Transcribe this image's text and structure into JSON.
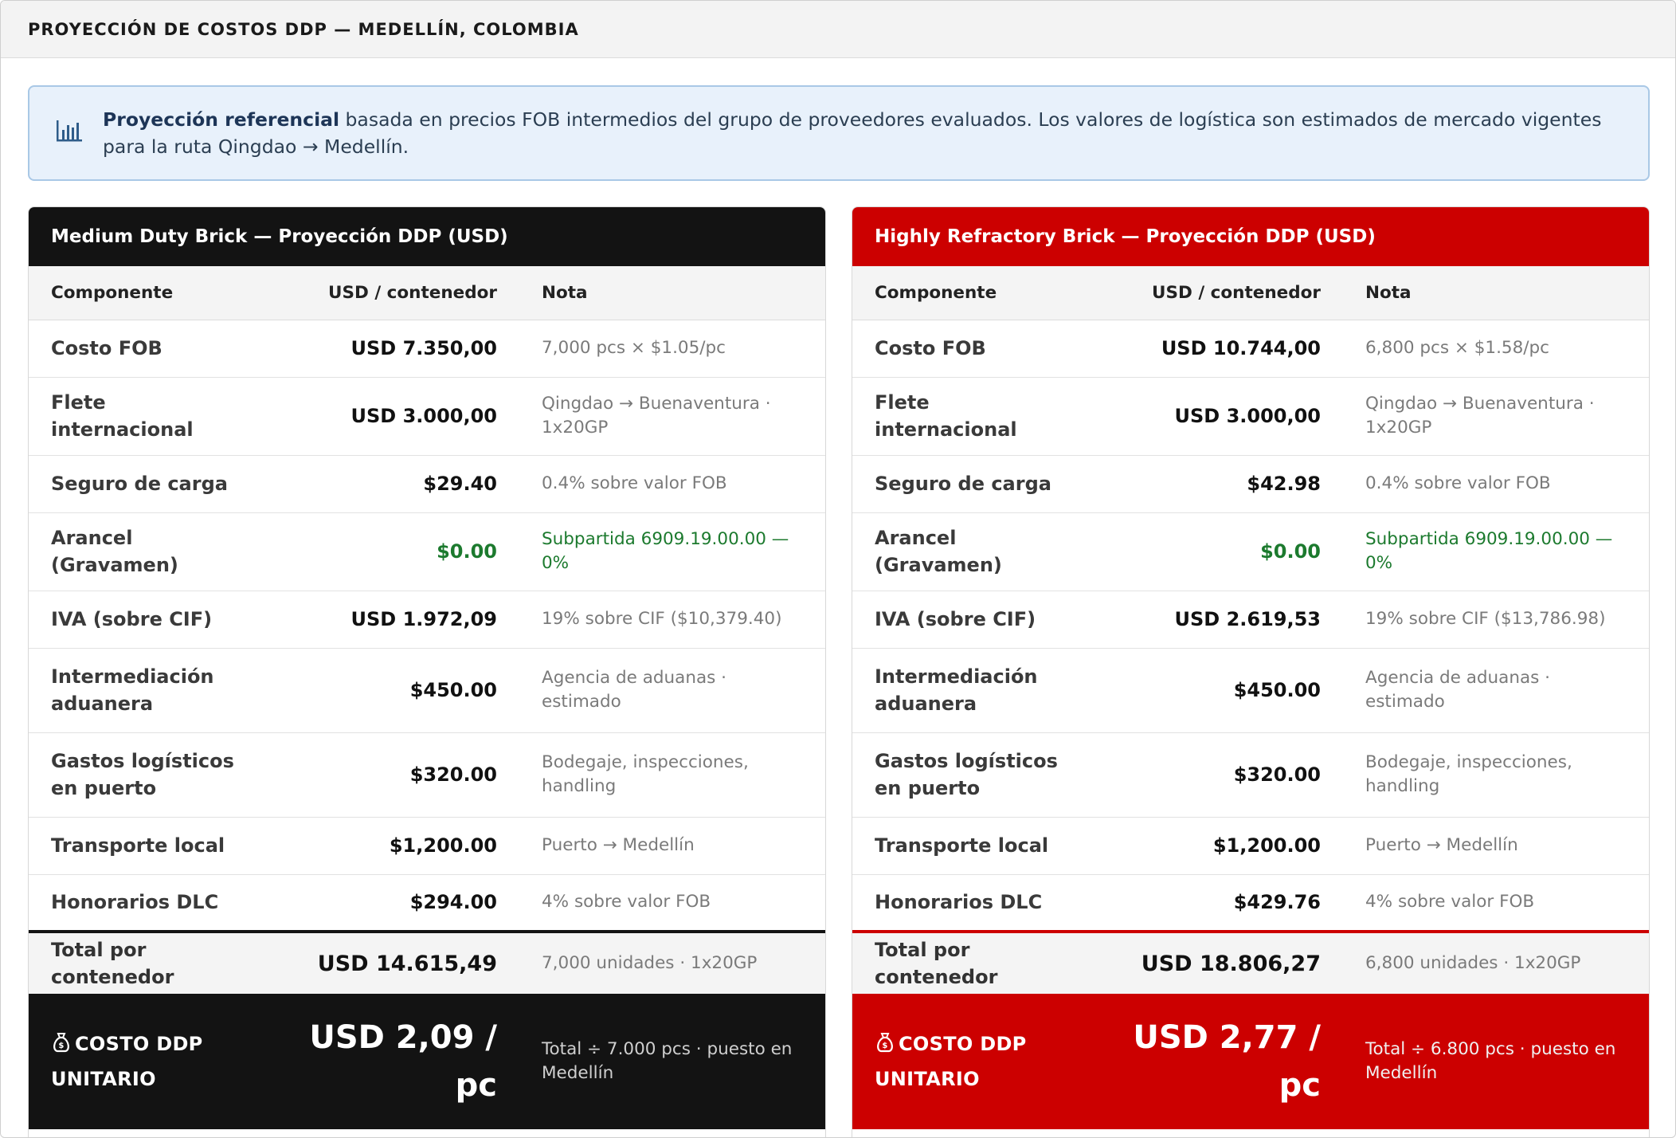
{
  "header": {
    "title": "PROYECCIÓN DE COSTOS DDP — MEDELLÍN, COLOMBIA"
  },
  "info": {
    "icon": "bar-chart-icon",
    "bold": "Proyección referencial",
    "text": " basada en precios FOB intermedios del grupo de proveedores evaluados. Los valores de logística son estimados de mercado vigentes para la ruta Qingdao → Medellín."
  },
  "colors": {
    "left_accent": "#131313",
    "right_accent": "#cc0000",
    "green": "#1c7a2e",
    "info_bg": "#e8f1fb"
  },
  "columns": {
    "component": "Componente",
    "usd": "USD / contenedor",
    "note": "Nota"
  },
  "panels": [
    {
      "title": "Medium Duty Brick — Proyección DDP (USD)",
      "rows": [
        {
          "label": "Costo FOB",
          "value": "USD 7.350,00",
          "note": "7,000 pcs × $1.05/pc"
        },
        {
          "label": "Flete internacional",
          "value": "USD 3.000,00",
          "note": "Qingdao → Buenaventura · 1x20GP"
        },
        {
          "label": "Seguro de carga",
          "value": "$29.40",
          "note": "0.4% sobre valor FOB"
        },
        {
          "label": "Arancel (Gravamen)",
          "value": "$0.00",
          "note": "Subpartida 6909.19.00.00 — 0%"
        },
        {
          "label": "IVA (sobre CIF)",
          "value": "USD 1.972,09",
          "note": "19% sobre CIF ($10,379.40)"
        },
        {
          "label": "Intermediación aduanera",
          "value": "$450.00",
          "note": "Agencia de aduanas · estimado"
        },
        {
          "label": "Gastos logísticos en puerto",
          "value": "$320.00",
          "note": "Bodegaje, inspecciones, handling"
        },
        {
          "label": "Transporte local",
          "value": "$1,200.00",
          "note": "Puerto → Medellín"
        },
        {
          "label": "Honorarios DLC",
          "value": "$294.00",
          "note": "4% sobre valor FOB"
        }
      ],
      "total": {
        "label": "Total por contenedor",
        "value": "USD 14.615,49",
        "note": "7,000 unidades · 1x20GP"
      },
      "unit": {
        "icon": "money-bag-icon",
        "label": "COSTO DDP UNITARIO",
        "value": "USD 2,09 / pc",
        "note": "Total ÷ 7.000 pcs · puesto en Medellín"
      }
    },
    {
      "title": "Highly Refractory Brick — Proyección DDP (USD)",
      "rows": [
        {
          "label": "Costo FOB",
          "value": "USD 10.744,00",
          "note": "6,800 pcs × $1.58/pc"
        },
        {
          "label": "Flete internacional",
          "value": "USD 3.000,00",
          "note": "Qingdao → Buenaventura · 1x20GP"
        },
        {
          "label": "Seguro de carga",
          "value": "$42.98",
          "note": "0.4% sobre valor FOB"
        },
        {
          "label": "Arancel (Gravamen)",
          "value": "$0.00",
          "note": "Subpartida 6909.19.00.00 — 0%"
        },
        {
          "label": "IVA (sobre CIF)",
          "value": "USD 2.619,53",
          "note": "19% sobre CIF ($13,786.98)"
        },
        {
          "label": "Intermediación aduanera",
          "value": "$450.00",
          "note": "Agencia de aduanas · estimado"
        },
        {
          "label": "Gastos logísticos en puerto",
          "value": "$320.00",
          "note": "Bodegaje, inspecciones, handling"
        },
        {
          "label": "Transporte local",
          "value": "$1,200.00",
          "note": "Puerto → Medellín"
        },
        {
          "label": "Honorarios DLC",
          "value": "$429.76",
          "note": "4% sobre valor FOB"
        }
      ],
      "total": {
        "label": "Total por contenedor",
        "value": "USD 18.806,27",
        "note": "6,800 unidades · 1x20GP"
      },
      "unit": {
        "icon": "money-bag-icon",
        "label": "COSTO DDP UNITARIO",
        "value": "USD 2,77 / pc",
        "note": "Total ÷ 6.800 pcs · puesto en Medellín"
      }
    }
  ]
}
